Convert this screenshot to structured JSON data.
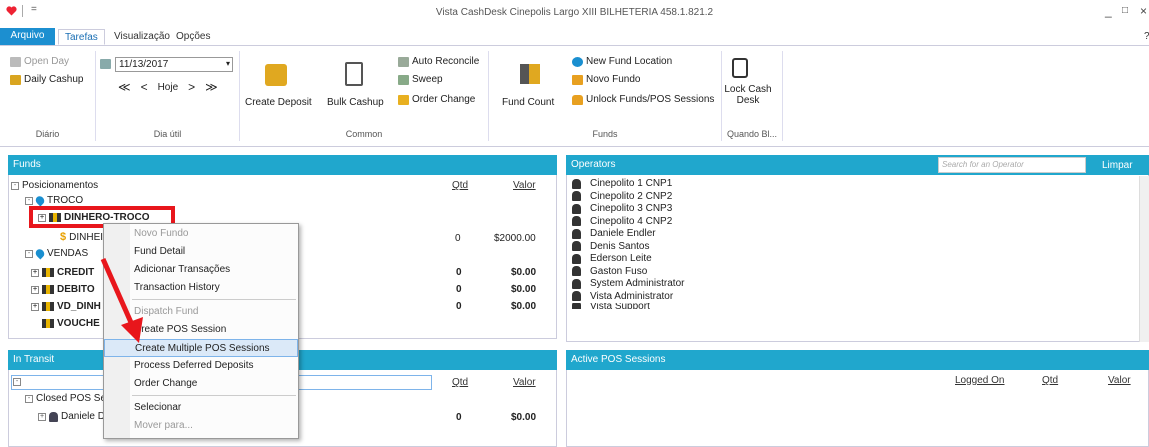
{
  "window": {
    "title": "Vista CashDesk  Cinepolis Largo XIII  BILHETERIA  458.1.821.2",
    "qa": "=",
    "min": "_",
    "max": "□",
    "close": "×",
    "help": "?"
  },
  "tabs": {
    "file": "Arquivo",
    "tasks": "Tarefas",
    "view": "Visualização",
    "options": "Opções"
  },
  "ribbon": {
    "diario": {
      "open_day": "Open Day",
      "daily_cashup": "Daily Cashup",
      "label": "Diário"
    },
    "dia_util": {
      "date": "11/13/2017",
      "prev_all": "≪",
      "prev": "<",
      "today": "Hoje",
      "next": ">",
      "next_all": "≫",
      "label": "Dia útil"
    },
    "common": {
      "create_deposit": "Create Deposit",
      "bulk_cashup": "Bulk Cashup",
      "auto_reconcile": "Auto Reconcile",
      "sweep": "Sweep",
      "order_change": "Order Change",
      "label": "Common"
    },
    "funds": {
      "fund_count": "Fund Count",
      "new_fund_location": "New Fund Location",
      "novo_fundo": "Novo Fundo",
      "unlock": "Unlock Funds/POS Sessions",
      "label": "Funds"
    },
    "quando": {
      "lock_line1": "Lock Cash",
      "lock_line2": "Desk",
      "label": "Quando Bl..."
    }
  },
  "funds_pane": {
    "title": "Funds",
    "root": "Posicionamentos",
    "col_qtd": "Qtd",
    "col_valor": "Valor",
    "troco": "TROCO",
    "dinheiro_troco": "DINHERO-TROCO",
    "dinheiro_child": "DINHEI",
    "dinheiro_qtd": "0",
    "dinheiro_val": "$2000.00",
    "vendas": "VENDAS",
    "rows": [
      {
        "name": "CREDIT",
        "qtd": "0",
        "val": "$0.00"
      },
      {
        "name": "DEBITO",
        "qtd": "0",
        "val": "$0.00"
      },
      {
        "name": "VD_DINH",
        "qtd": "0",
        "val": "$0.00"
      },
      {
        "name": "VOUCHE",
        "qtd": "",
        "val": ""
      }
    ]
  },
  "transit_pane": {
    "title": "In Transit",
    "col_qtd": "Qtd",
    "col_valor": "Valor",
    "closed": "Closed POS Ses",
    "daniele": "Daniele D",
    "qtd": "0",
    "val": "$0.00"
  },
  "operators_pane": {
    "title": "Operators",
    "search_placeholder": "Search for an Operator",
    "clear": "Limpar",
    "operators": [
      "Cinepolito 1 CNP1",
      "Cinepolito 2 CNP2",
      "Cinepolito 3 CNP3",
      "Cinepolito 4 CNP2",
      "Daniele Endler",
      "Denis Santos",
      "Ederson Leite",
      "Gaston Fuso",
      "System Administrator",
      "Vista Administrator",
      "Vista Support"
    ]
  },
  "pos_pane": {
    "title": "Active POS Sessions",
    "col_logged": "Logged On",
    "col_qtd": "Qtd",
    "col_valor": "Valor"
  },
  "context_menu": {
    "items": [
      "Novo Fundo",
      "Fund Detail",
      "Adicionar Transações",
      "Transaction History",
      "Dispatch Fund",
      "Create POS Session",
      "Create Multiple POS Sessions",
      "Process Deferred Deposits",
      "Order Change",
      "Selecionar",
      "Mover para..."
    ]
  },
  "colors": {
    "accent": "#20a7cd",
    "file_tab": "#1c8fd0",
    "annotation": "#e8161c"
  }
}
